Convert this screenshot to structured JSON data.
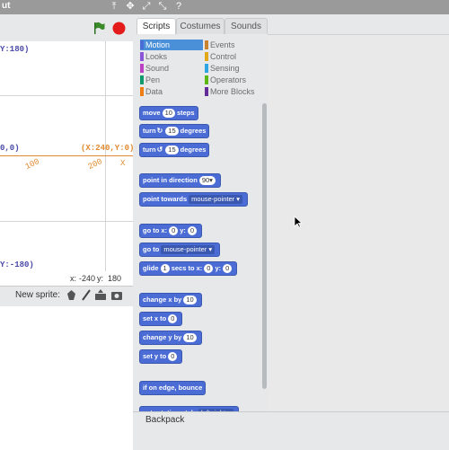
{
  "window": {
    "title_fragment": "ut"
  },
  "stage": {
    "coords": {
      "top": "Y:180)",
      "center_left": "0,0)",
      "right": "(X:240,Y:0)",
      "bottom": "Y:-180)",
      "axis_100": "100",
      "axis_200": "200",
      "axis_x_marker": "X"
    },
    "mouse_x_label": "x:",
    "mouse_x": "-240",
    "mouse_y_label": "y:",
    "mouse_y": "180",
    "new_sprite_label": "New sprite:"
  },
  "tabs": [
    {
      "label": "Scripts"
    },
    {
      "label": "Costumes"
    },
    {
      "label": "Sounds"
    }
  ],
  "categories": [
    {
      "label": "Motion",
      "color": "#4a6cd4"
    },
    {
      "label": "Events",
      "color": "#c88330"
    },
    {
      "label": "Looks",
      "color": "#8a55d7"
    },
    {
      "label": "Control",
      "color": "#e1a91a"
    },
    {
      "label": "Sound",
      "color": "#bb42c3"
    },
    {
      "label": "Sensing",
      "color": "#2ca5e2"
    },
    {
      "label": "Pen",
      "color": "#0e9a6c"
    },
    {
      "label": "Operators",
      "color": "#5cb712"
    },
    {
      "label": "Data",
      "color": "#ee7d16"
    },
    {
      "label": "More Blocks",
      "color": "#632d99"
    }
  ],
  "blocks": {
    "move": {
      "pre": "move",
      "val": "10",
      "post": "steps"
    },
    "turn_cw": {
      "pre": "turn",
      "sym": "↻",
      "val": "15",
      "post": "degrees"
    },
    "turn_ccw": {
      "pre": "turn",
      "sym": "↺",
      "val": "15",
      "post": "degrees"
    },
    "point_dir": {
      "pre": "point in direction",
      "val": "90▾"
    },
    "point_towards": {
      "pre": "point towards",
      "val": "mouse-pointer ▾"
    },
    "goto_xy": {
      "pre": "go to x:",
      "x": "0",
      "mid": "y:",
      "y": "0"
    },
    "goto": {
      "pre": "go to",
      "val": "mouse-pointer ▾"
    },
    "glide": {
      "pre": "glide",
      "secs": "1",
      "mid1": "secs to x:",
      "x": "0",
      "mid2": "y:",
      "y": "0"
    },
    "change_x": {
      "pre": "change x by",
      "val": "10"
    },
    "set_x": {
      "pre": "set x to",
      "val": "0"
    },
    "change_y": {
      "pre": "change y by",
      "val": "10"
    },
    "set_y": {
      "pre": "set y to",
      "val": "0"
    },
    "bounce": {
      "label": "if on edge, bounce"
    },
    "rotation": {
      "pre": "set rotation style",
      "val": "left-right ▾"
    }
  },
  "backpack": {
    "label": "Backpack"
  },
  "colors": {
    "motion_block": "#4a6cd4",
    "green_flag": "#3a8a2a",
    "stop": "#e41b1b"
  }
}
